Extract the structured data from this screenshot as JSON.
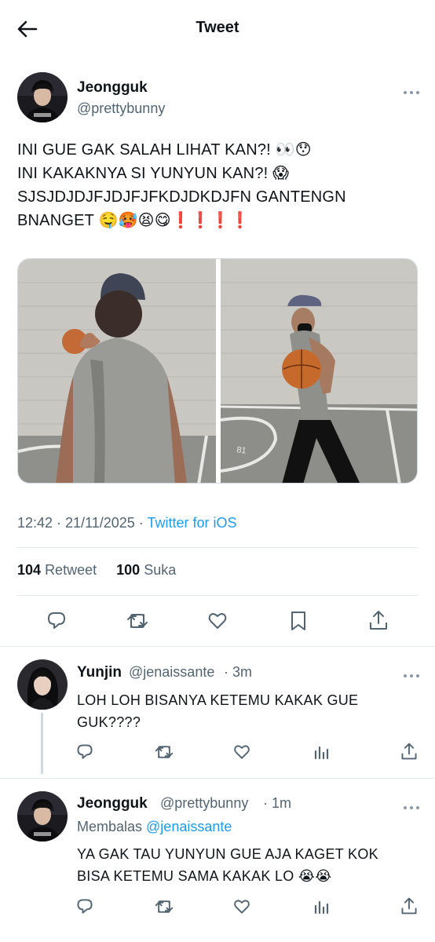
{
  "header": {
    "title": "Tweet"
  },
  "tweet": {
    "author": {
      "name": "Jeongguk",
      "handle": "@prettybunny"
    },
    "text_lines": [
      "INI GUE GAK SALAH LIHAT KAN?! 👀😯",
      "INI KAKAKNYA SI YUNYUN KAN?! 😱",
      "SJSJDJDJFJDJFJFKDJDKDJFN GANTENGN",
      "BNANGET 🤤🥵😫😋❗❗❗❗"
    ],
    "time": "12:42 · 21/11/2025 · ",
    "source": "Twitter for iOS",
    "retweet_count": "104",
    "retweet_label": "Retweet",
    "like_count": "100",
    "like_label": "Suka"
  },
  "replies": [
    {
      "name": "Yunjin",
      "handle": "@jenaissante",
      "time": "· 3m",
      "lines": [
        "LOH LOH BISANYA KETEMU KAKAK GUE",
        "GUK????"
      ]
    },
    {
      "name": "Jeongguk",
      "handle": "@prettybunny",
      "time": "· 1m",
      "replying_prefix": "Membalas ",
      "replying_to": "@jenaissante",
      "lines": [
        "YA GAK TAU YUNYUN GUE AJA KAGET KOK",
        "BISA KETEMU SAMA KAKAK LO 😭😭"
      ]
    }
  ],
  "icons": {
    "back": "arrow-left-icon",
    "reply": "comment-icon",
    "retweet": "retweet-icon",
    "like": "heart-icon",
    "bookmark": "bookmark-icon",
    "share": "share-icon",
    "analytics": "bar-chart-icon",
    "more": "more-dots-icon"
  },
  "colors": {
    "link": "#1d9bf0",
    "secondary_text": "#536471",
    "divider": "#e1e8ed"
  }
}
